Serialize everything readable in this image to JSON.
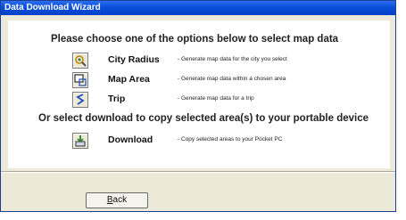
{
  "window": {
    "title": "Data Download Wizard"
  },
  "panel": {
    "heading": "Please choose one of the options below to select map data",
    "options": [
      {
        "label": "City Radius",
        "description": "- Generate map data for the city you select",
        "icon": "city-radius-icon"
      },
      {
        "label": "Map Area",
        "description": "- Generate map data within a chosen area",
        "icon": "map-area-icon"
      },
      {
        "label": "Trip",
        "description": "- Generate map data for a trip",
        "icon": "trip-icon"
      }
    ],
    "subheading": "Or select download to copy selected area(s) to your portable device",
    "download": {
      "label": "Download",
      "description": "- Copy selected areas to your Pocket PC",
      "icon": "download-icon"
    }
  },
  "footer": {
    "back_prefix": "B",
    "back_rest": "ack"
  }
}
